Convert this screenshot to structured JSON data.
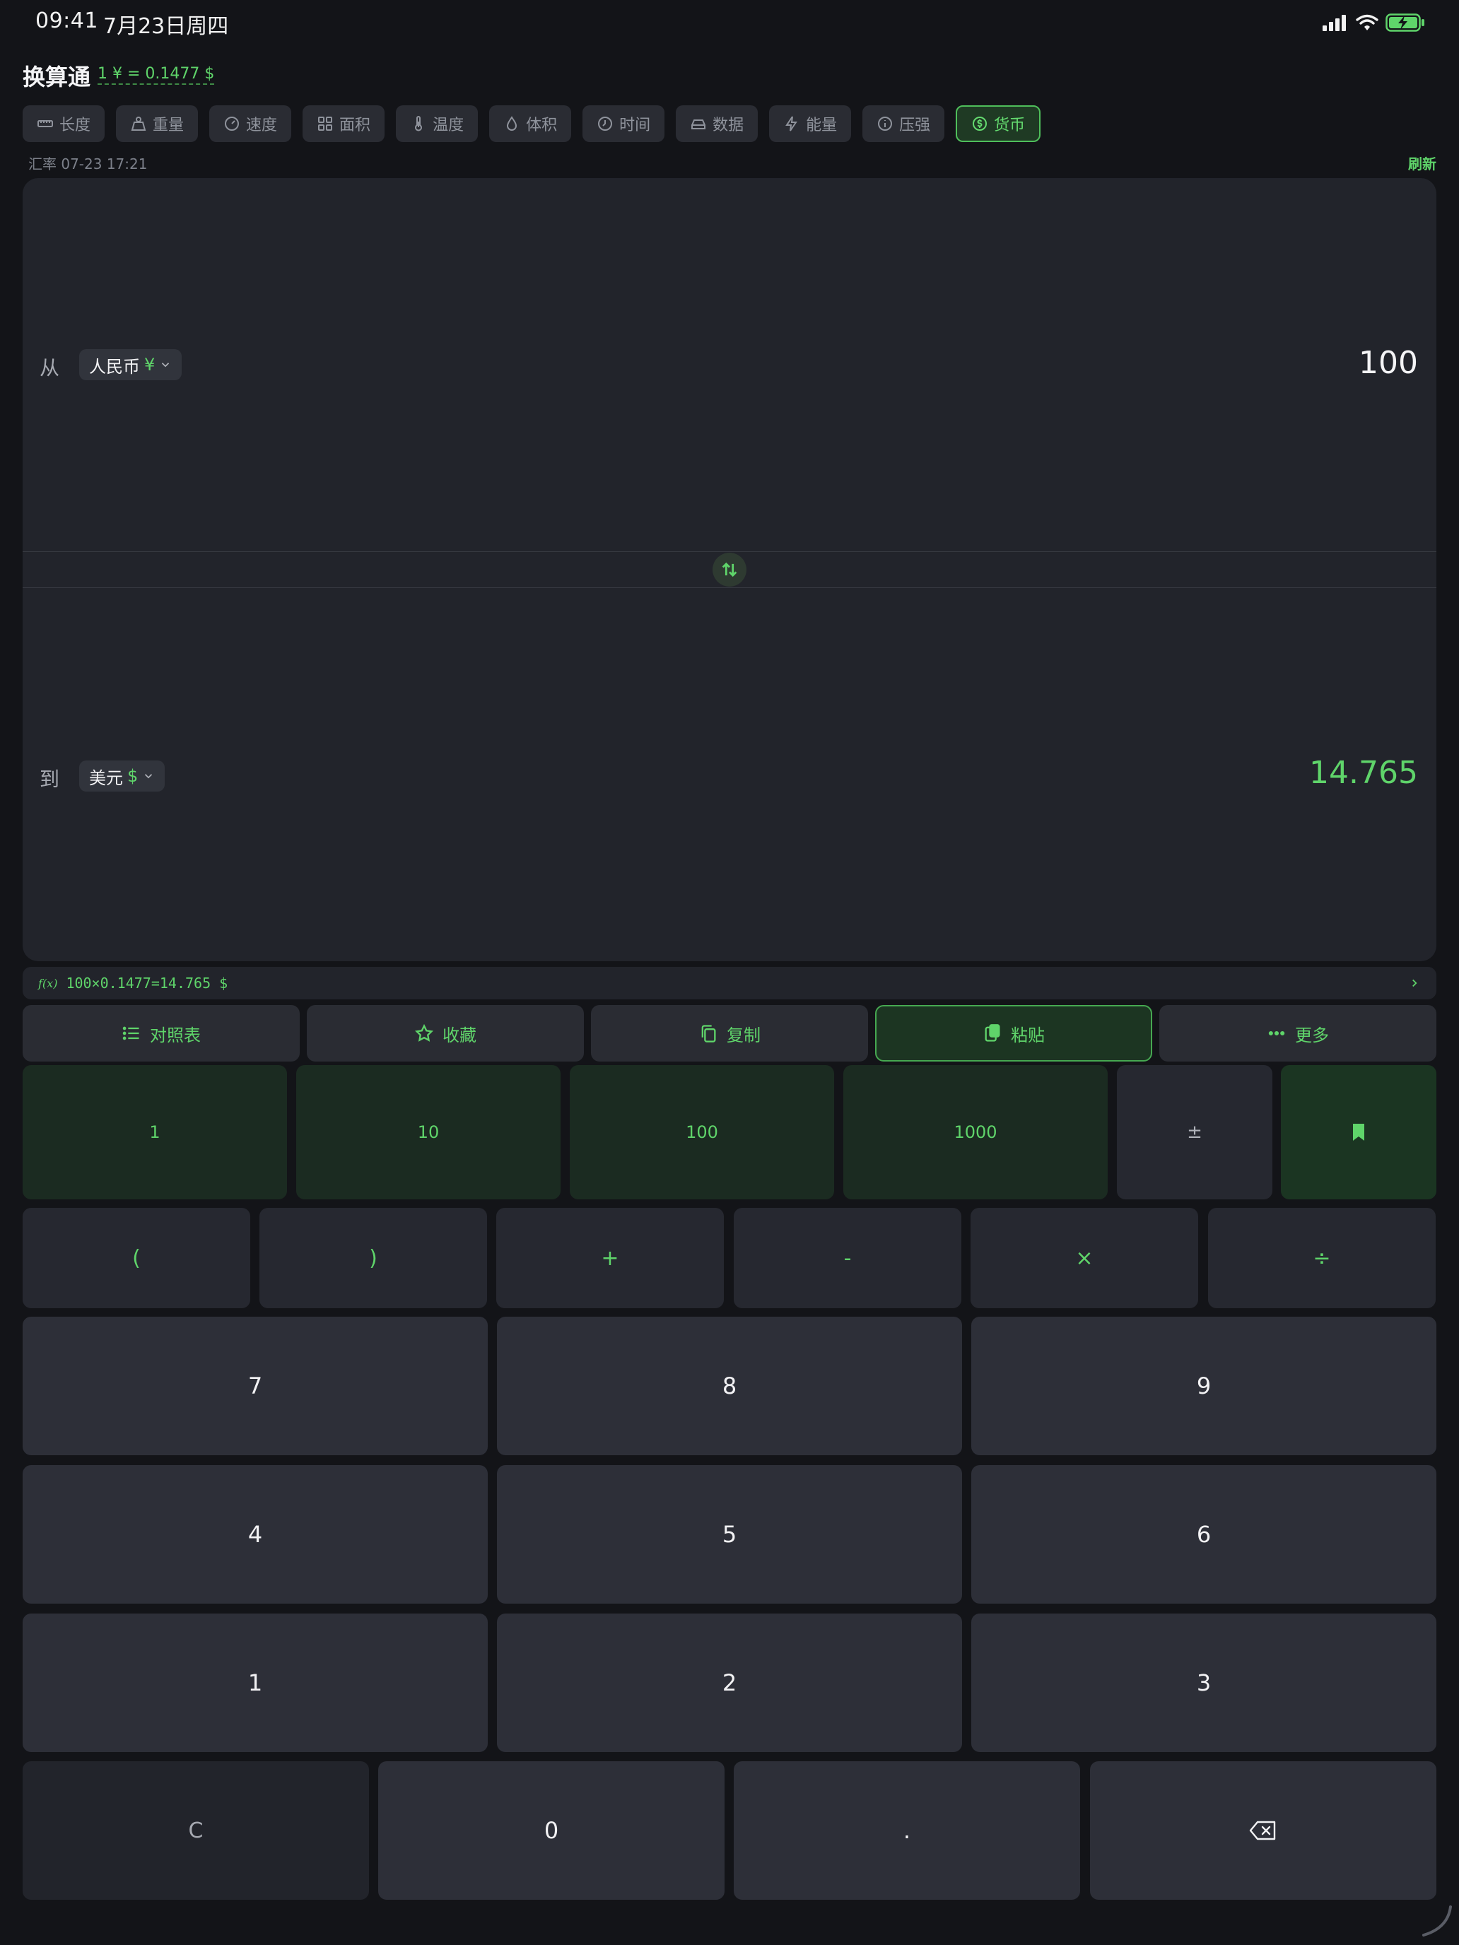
{
  "status_bar": {
    "time": "09:41",
    "date": "7月23日周四",
    "icons": [
      "signal-icon",
      "wifi-icon",
      "battery-charging-icon"
    ]
  },
  "header": {
    "title": "换算通",
    "rate": "1 ¥ = 0.1477 $"
  },
  "tabs": [
    {
      "label": "长度",
      "icon": "ruler-icon",
      "active": false
    },
    {
      "label": "重量",
      "icon": "weight-icon",
      "active": false
    },
    {
      "label": "速度",
      "icon": "speedometer-icon",
      "active": false
    },
    {
      "label": "面积",
      "icon": "grid-icon",
      "active": false
    },
    {
      "label": "温度",
      "icon": "thermometer-icon",
      "active": false
    },
    {
      "label": "体积",
      "icon": "droplet-icon",
      "active": false
    },
    {
      "label": "时间",
      "icon": "clock-icon",
      "active": false
    },
    {
      "label": "数据",
      "icon": "drive-icon",
      "active": false
    },
    {
      "label": "能量",
      "icon": "bolt-icon",
      "active": false
    },
    {
      "label": "压强",
      "icon": "gauge-icon",
      "active": false
    },
    {
      "label": "货币",
      "icon": "dollar-coin-icon",
      "active": true
    }
  ],
  "rate_info": {
    "updated": "汇率 07-23 17:21",
    "refresh_label": "刷新"
  },
  "converter": {
    "from_label": "从",
    "from_unit": "人民币",
    "from_symbol": "¥",
    "from_value": "100",
    "to_label": "到",
    "to_unit": "美元",
    "to_symbol": "$",
    "to_value": "14.765"
  },
  "formula": {
    "prefix": "f(x)",
    "expression": "100×0.1477=14.765 $"
  },
  "actions": [
    {
      "label": "对照表",
      "icon": "list-icon"
    },
    {
      "label": "收藏",
      "icon": "star-icon"
    },
    {
      "label": "复制",
      "icon": "copy-icon"
    },
    {
      "label": "粘贴",
      "icon": "paste-icon",
      "active": true
    },
    {
      "label": "更多",
      "icon": "more-icon"
    }
  ],
  "keypad": {
    "presets": [
      "1",
      "10",
      "100",
      "1000"
    ],
    "sign": "±",
    "bookmark_icon": "bookmark-icon",
    "operators": [
      "(",
      ")",
      "+",
      "-",
      "×",
      "÷"
    ],
    "digits": [
      "7",
      "8",
      "9",
      "4",
      "5",
      "6",
      "1",
      "2",
      "3"
    ],
    "clear": "C",
    "zero": "0",
    "dot": ".",
    "backspace_icon": "backspace-icon"
  },
  "colors": {
    "accent": "#5fd46a",
    "background": "#131418",
    "panel": "#22242b"
  }
}
